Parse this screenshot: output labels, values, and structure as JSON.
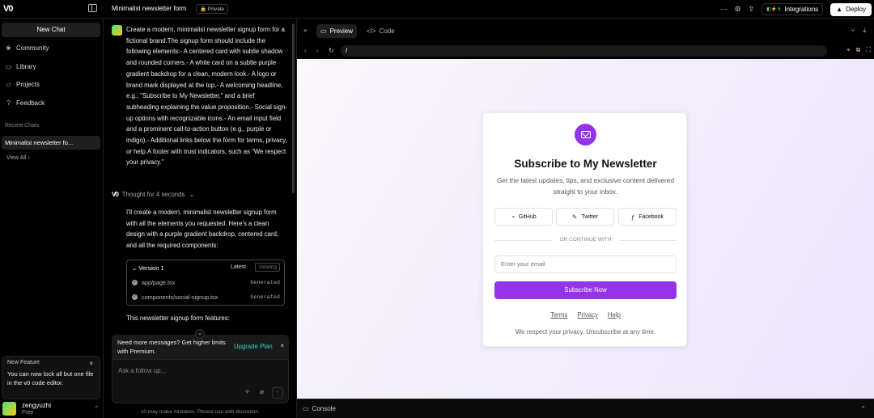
{
  "topbar": {
    "logo": "V0",
    "chat_title": "Minimalist newsletter form",
    "private_badge": "🔒 Private",
    "integrations_label": "Integrations",
    "deploy_label": "Deploy"
  },
  "sidebar": {
    "new_chat": "New Chat",
    "items": [
      {
        "label": "Community",
        "icon": "community-icon",
        "glyph": "❀"
      },
      {
        "label": "Library",
        "icon": "library-icon",
        "glyph": "▭"
      },
      {
        "label": "Projects",
        "icon": "projects-icon",
        "glyph": "▱"
      },
      {
        "label": "Feedback",
        "icon": "feedback-icon",
        "glyph": "?"
      }
    ],
    "recent_label": "Recent Chats",
    "recent_item": "Minimalist newsletter fo...",
    "view_all": "View All",
    "new_feature": {
      "title": "New Feature",
      "text": "You can now lock all but one file in the v0 code editor."
    },
    "user": {
      "name": "zengyuzhi",
      "plan": "Free"
    }
  },
  "chat": {
    "user_message": "Create a modern, minimalist newsletter signup form for a fictional brand.The signup form should include the following elements:- A centered card with subtle shadow and rounded corners.- A white card on a subtle purple gradient backdrop for a clean, modern look.- A logo or brand mark displayed at the top.- A welcoming headline, e.g., \"Subscribe to My Newsletter,\" and a brief subheading explaining the value proposition.- Social sign-up options with recognizable icons.- An email input field and a prominent call-to-action button (e.g., purple or indigo).- Additional links below the form for terms, privacy, or help.A footer with trust indicators, such as \"We respect your privacy.\"",
    "thought": "Thought for 4 seconds",
    "assistant_message": "I'll create a modern, minimalist newsletter signup form with all the elements you requested. Here's a clean design with a purple gradient backdrop, centered card, and all the required components:",
    "version": {
      "title": "Version 1",
      "latest": "Latest",
      "viewing": "Viewing",
      "files": [
        {
          "name": "app/page.tsx",
          "status": "Generated"
        },
        {
          "name": "components/social-signup.tsx",
          "status": "Generated"
        }
      ]
    },
    "features_heading": "This newsletter signup form features:",
    "upgrade": {
      "text": "Need more messages? Get higher limits with Premium.",
      "link": "Upgrade Plan"
    },
    "input_placeholder": "Ask a follow up...",
    "disclaimer": "v0 may make mistakes. Please use with discretion."
  },
  "preview": {
    "tabs": [
      "Preview",
      "Code"
    ],
    "url": "/",
    "console_label": "Console",
    "card": {
      "title": "Subscribe to My Newsletter",
      "subtitle": "Get the latest updates, tips, and exclusive content delivered straight to your inbox.",
      "social": [
        "GitHub",
        "Twitter",
        "Facebook"
      ],
      "divider": "OR CONTINUE WITH",
      "email_placeholder": "Enter your email",
      "button": "Subscribe Now",
      "links": [
        "Terms",
        "Privacy",
        "Help"
      ],
      "footer": "We respect your privacy. Unsubscribe at any time."
    }
  },
  "colors": {
    "accent": "#9333ea",
    "upgrade_link": "#2dd4bf"
  }
}
